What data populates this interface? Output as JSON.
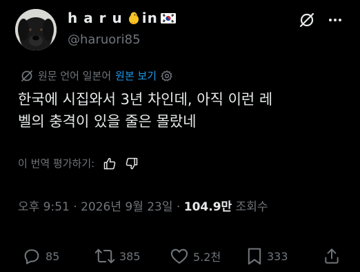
{
  "user": {
    "display_name": "h a r u",
    "name_suffix": "in",
    "handle": "@haruori85"
  },
  "translation": {
    "source_text": "원문 언어 일본어",
    "view_original_label": "원본 보기"
  },
  "tweet": {
    "line1": "한국에 시집와서 3년 차인데, 아직 이런 레",
    "line2": "벨의 충격이 있을 줄은 몰랐네"
  },
  "rate": {
    "label": "이 번역 평가하기:"
  },
  "meta": {
    "time": "오후 9:51",
    "separator": "·",
    "date": "2026년 9월 23일",
    "views": "104.9만",
    "views_label": "조회수"
  },
  "actions": {
    "replies": "85",
    "retweets": "385",
    "likes": "5.2천",
    "bookmarks": "333"
  },
  "colors": {
    "background": "#000000",
    "text": "#e7e9ea",
    "muted": "#71767b",
    "link": "#1d9bf0"
  }
}
